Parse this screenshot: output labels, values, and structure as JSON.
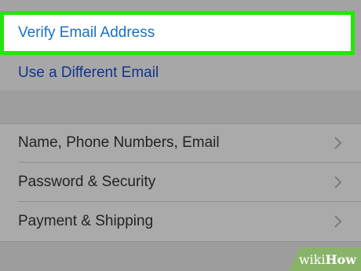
{
  "account": {
    "verify_email_label": "Verify Email Address",
    "different_email_label": "Use a Different Email"
  },
  "settings": {
    "items": [
      {
        "label": "Name, Phone Numbers, Email",
        "icon": "chevron-right-icon"
      },
      {
        "label": "Password & Security",
        "icon": "chevron-right-icon"
      },
      {
        "label": "Payment & Shipping",
        "icon": "chevron-right-icon"
      }
    ]
  },
  "watermark": {
    "prefix": "wiki",
    "suffix": "How"
  },
  "colors": {
    "highlight": "#25e60a",
    "link_blue": "#1a6fc2",
    "dark_link": "#11348a",
    "background": "#a9a9aa"
  }
}
